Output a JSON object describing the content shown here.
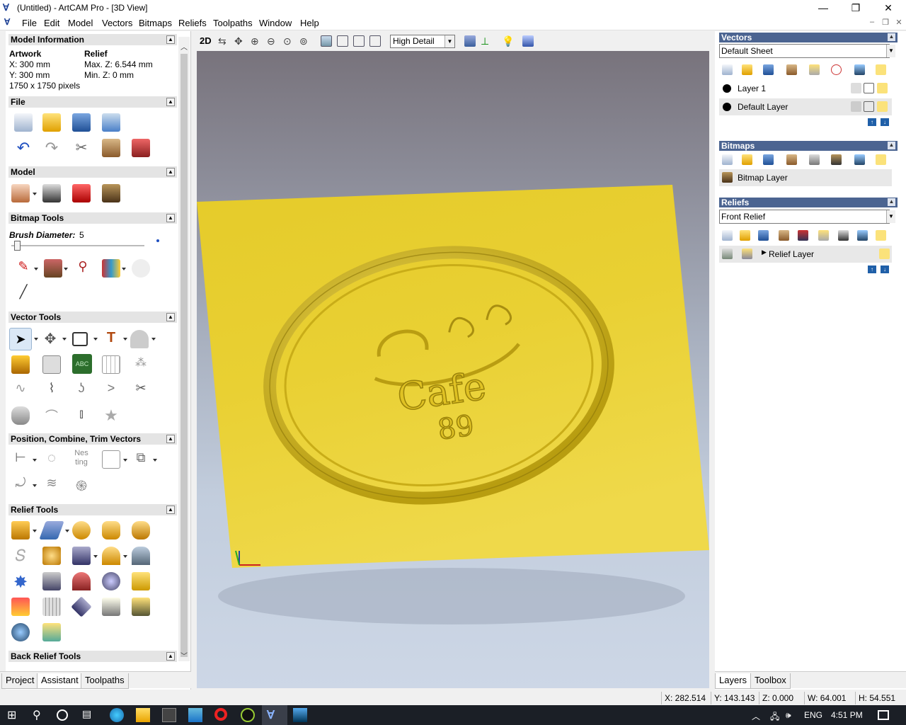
{
  "window": {
    "title": "(Untitled) - ArtCAM Pro - [3D View]",
    "minimize": "—",
    "restore": "❐",
    "close": "✕"
  },
  "menu": [
    "File",
    "Edit",
    "Model",
    "Vectors",
    "Bitmaps",
    "Reliefs",
    "Toolpaths",
    "Window",
    "Help"
  ],
  "left": {
    "model_info": {
      "header": "Model Information",
      "artwork": "Artwork",
      "relief": "Relief",
      "x": "X: 300 mm",
      "y": "Y: 300 mm",
      "maxz": "Max. Z: 6.544 mm",
      "minz": "Min. Z: 0 mm",
      "pixels": "1750 x 1750 pixels"
    },
    "file": "File",
    "model": "Model",
    "bitmap_tools": "Bitmap Tools",
    "brush_label": "Brush Diameter:",
    "brush_value": "5",
    "vector_tools": "Vector Tools",
    "position": "Position, Combine, Trim Vectors",
    "relief_tools": "Relief Tools",
    "back_relief": "Back Relief Tools",
    "tabs": [
      "Project",
      "Assistant",
      "Toolpaths"
    ]
  },
  "toolbar": {
    "mode": "2D",
    "detail": "High Detail"
  },
  "right": {
    "vectors": {
      "header": "Vectors",
      "sheet": "Default Sheet",
      "layers": [
        "Layer 1",
        "Default Layer"
      ]
    },
    "bitmaps": {
      "header": "Bitmaps",
      "layer": "Bitmap Layer"
    },
    "reliefs": {
      "header": "Reliefs",
      "relief": "Front Relief",
      "layer": "Relief Layer"
    },
    "tabs": [
      "Layers",
      "Toolbox"
    ]
  },
  "status": {
    "x": "X: 282.514",
    "y": "Y: 143.143",
    "z": "Z: 0.000",
    "w": "W: 64.001",
    "h": "H: 54.551"
  },
  "taskbar": {
    "lang": "ENG",
    "time": "4:51 PM"
  },
  "relief_text": {
    "top": "Cafe",
    "bottom": "89"
  },
  "colors": {
    "relief": "#e5cb2a",
    "panel_header": "#4b6491",
    "taskbar": "#1b1f26"
  }
}
